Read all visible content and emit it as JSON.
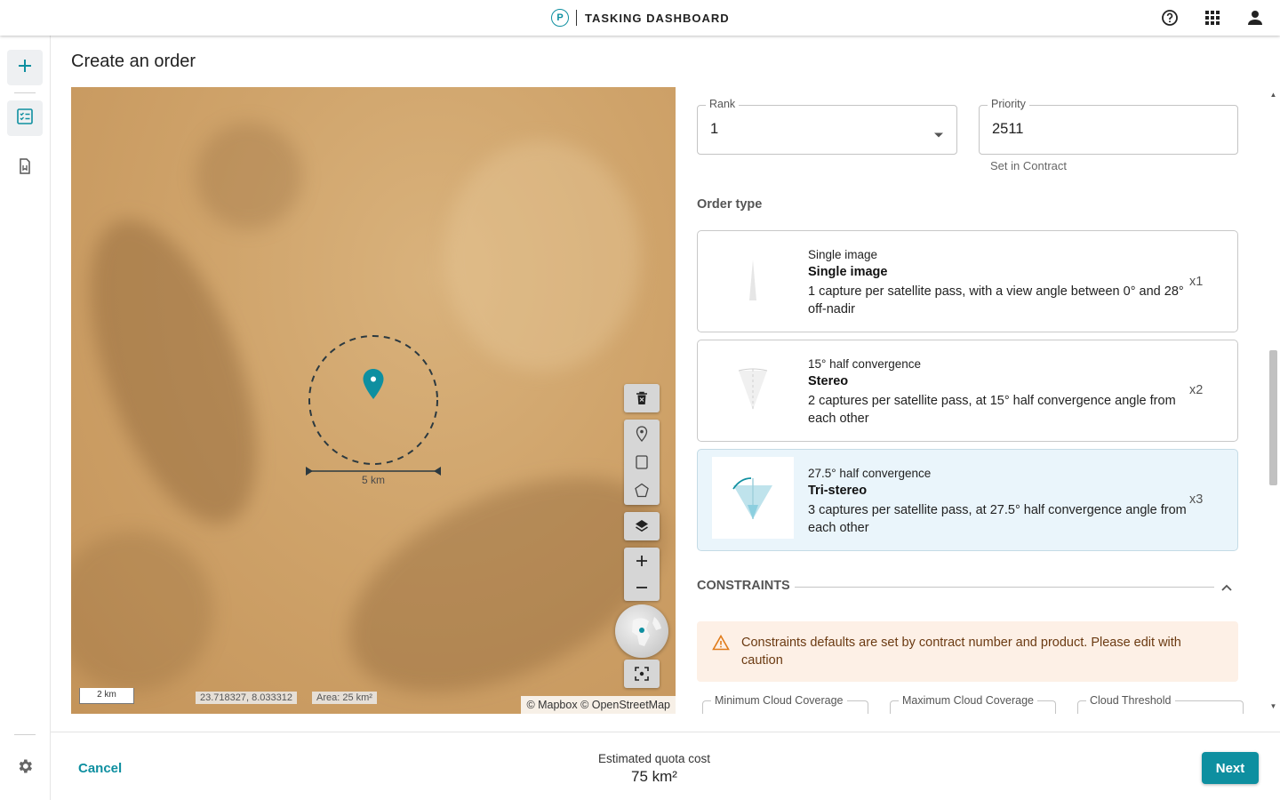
{
  "header": {
    "logo_letter": "P",
    "title": "TASKING DASHBOARD",
    "icons": [
      "help-icon",
      "apps-grid-icon",
      "account-icon"
    ]
  },
  "rail": {
    "items": [
      "add-icon",
      "orders-list-icon",
      "archive-icon"
    ],
    "bottom": "settings-icon"
  },
  "page": {
    "title": "Create an order"
  },
  "map": {
    "scale_label": "5 km",
    "scalebar_label": "2 km",
    "coordinates": "23.718327, 8.033312",
    "area": "Area: 25 km²",
    "attribution": "© Mapbox © OpenStreetMap",
    "controls": [
      "trash-icon",
      "pin-icon",
      "rectangle-icon",
      "polygon-icon",
      "layers-icon",
      "zoom-in-icon",
      "zoom-out-icon",
      "globe-icon",
      "recenter-icon"
    ]
  },
  "form": {
    "rank": {
      "label": "Rank",
      "value": "1"
    },
    "priority": {
      "label": "Priority",
      "value": "2511",
      "helper": "Set in Contract"
    },
    "order_type_title": "Order type",
    "order_types": [
      {
        "sub": "Single image",
        "name": "Single image",
        "desc": "1 capture per satellite pass, with a view angle between 0° and 28° off-nadir",
        "mult": "x1",
        "selected": false
      },
      {
        "sub": "15° half convergence",
        "name": "Stereo",
        "desc": "2 captures per satellite pass, at 15° half convergence angle from each other",
        "mult": "x2",
        "selected": false
      },
      {
        "sub": "27.5° half convergence",
        "name": "Tri-stereo",
        "desc": "3 captures per satellite pass, at 27.5° half convergence angle from each other",
        "mult": "x3",
        "selected": true
      }
    ],
    "constraints_title": "CONSTRAINTS",
    "warning": "Constraints defaults are set by contract number and product. Please edit with caution",
    "constraint_fields": [
      "Minimum Cloud Coverage",
      "Maximum Cloud Coverage",
      "Cloud Threshold"
    ]
  },
  "footer": {
    "cancel": "Cancel",
    "quota_label": "Estimated quota cost",
    "quota_value": "75 km²",
    "next": "Next"
  },
  "colors": {
    "accent": "#0e8fa0",
    "warning_bg": "#fdf0e6",
    "selected_bg": "#eaf5fb"
  }
}
